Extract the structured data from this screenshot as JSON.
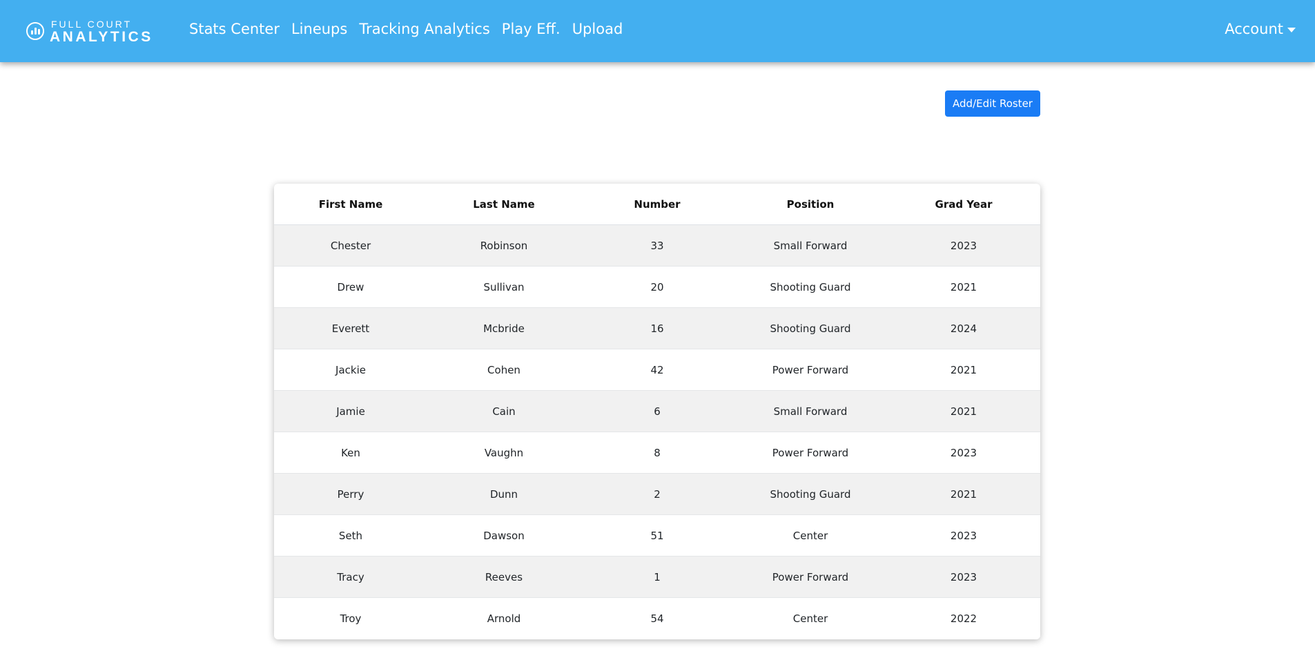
{
  "nav": {
    "brand_top": "FULL COURT",
    "brand_bottom": "ANALYTICS",
    "brand_icon": "bar-chart-icon",
    "links": [
      "Stats Center",
      "Lineups",
      "Tracking Analytics",
      "Play Eff.",
      "Upload"
    ],
    "account_label": "Account",
    "color": "#43aff0"
  },
  "toolbar": {
    "roster_button_label": "Add/Edit Roster",
    "button_color": "#1a7cf5"
  },
  "table": {
    "headers": [
      "First Name",
      "Last Name",
      "Number",
      "Position",
      "Grad Year"
    ],
    "rows": [
      [
        "Chester",
        "Robinson",
        "33",
        "Small Forward",
        "2023"
      ],
      [
        "Drew",
        "Sullivan",
        "20",
        "Shooting Guard",
        "2021"
      ],
      [
        "Everett",
        "Mcbride",
        "16",
        "Shooting Guard",
        "2024"
      ],
      [
        "Jackie",
        "Cohen",
        "42",
        "Power Forward",
        "2021"
      ],
      [
        "Jamie",
        "Cain",
        "6",
        "Small Forward",
        "2021"
      ],
      [
        "Ken",
        "Vaughn",
        "8",
        "Power Forward",
        "2023"
      ],
      [
        "Perry",
        "Dunn",
        "2",
        "Shooting Guard",
        "2021"
      ],
      [
        "Seth",
        "Dawson",
        "51",
        "Center",
        "2023"
      ],
      [
        "Tracy",
        "Reeves",
        "1",
        "Power Forward",
        "2023"
      ],
      [
        "Troy",
        "Arnold",
        "54",
        "Center",
        "2022"
      ]
    ]
  }
}
